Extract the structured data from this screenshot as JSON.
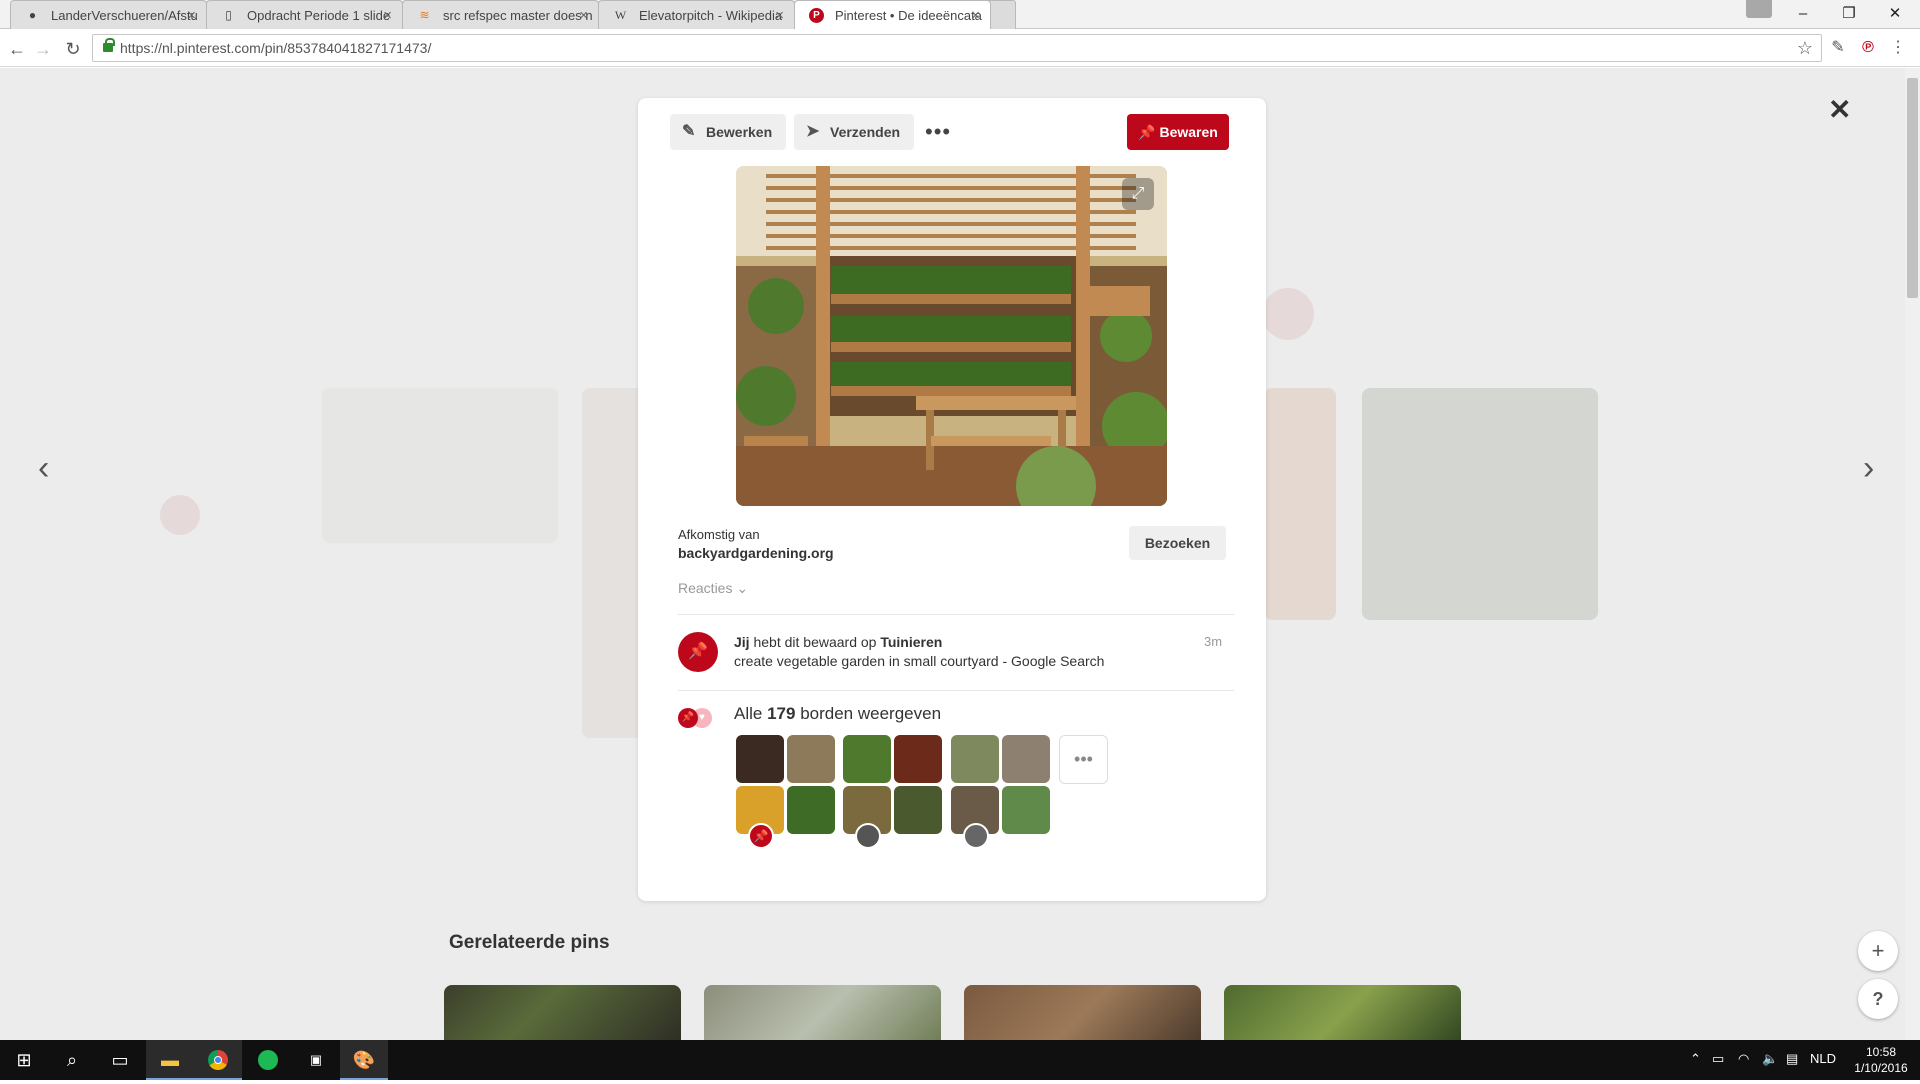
{
  "browser": {
    "tabs": [
      {
        "title": "LanderVerschueren/Afstu",
        "icon": "github-icon"
      },
      {
        "title": "Opdracht Periode 1 slide",
        "icon": "document-icon"
      },
      {
        "title": "src refspec master does n",
        "icon": "stackoverflow-icon"
      },
      {
        "title": "Elevatorpitch - Wikipedia",
        "icon": "wikipedia-icon"
      },
      {
        "title": "Pinterest • De ideeëncata",
        "icon": "pinterest-icon"
      }
    ],
    "url": "https://nl.pinterest.com/pin/853784041827171473/"
  },
  "modal": {
    "edit_label": "Bewerken",
    "send_label": "Verzenden",
    "more_label": "•••",
    "save_label": "Bewaren",
    "source_label": "Afkomstig van",
    "source_domain": "backyardgardening.org",
    "visit_label": "Bezoeken",
    "reactions_label": "Reacties ⌄",
    "activity": {
      "who": "Jij",
      "action": "hebt dit bewaard op",
      "board": "Tuinieren",
      "description": "create vegetable garden in small courtyard - Google Search",
      "time": "3m"
    },
    "boards": {
      "prefix": "Alle",
      "count": "179",
      "suffix": "borden weergeven",
      "more_label": "•••"
    }
  },
  "page": {
    "related_title": "Gerelateerde pins"
  },
  "taskbar": {
    "time": "10:58",
    "date": "1/10/2016",
    "language": "NLD"
  },
  "colors": {
    "pinterest_red": "#bd081c",
    "overlay": "#e9e9e9",
    "taskbar": "#101010"
  }
}
